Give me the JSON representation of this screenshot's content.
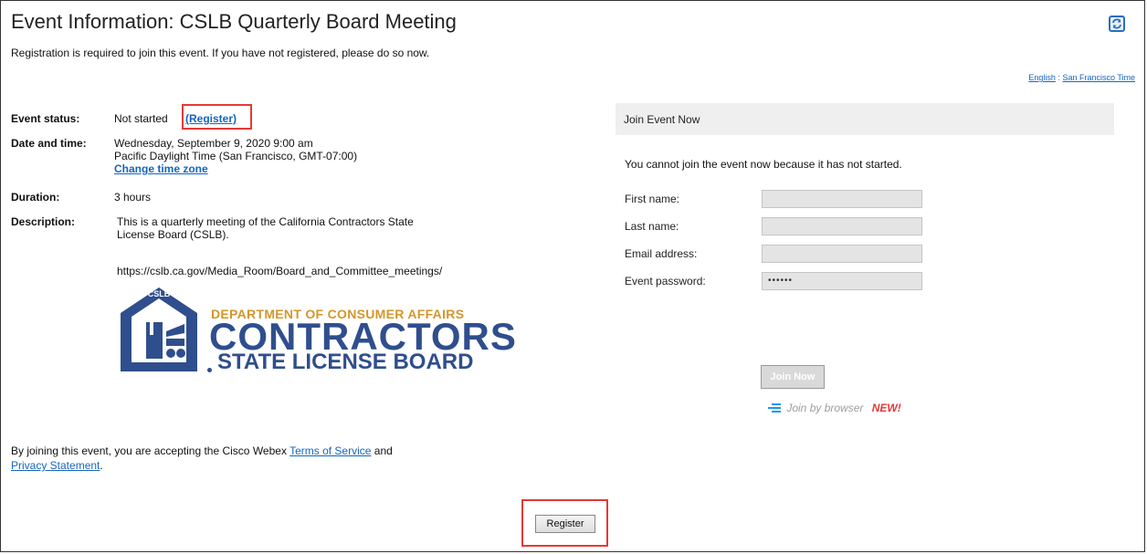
{
  "header": {
    "title": "Event Information: CSLB Quarterly Board Meeting",
    "intro": "Registration is required to join this event. If you have not registered, please do so now."
  },
  "locale": {
    "language_link": "English",
    "separator": ":",
    "timezone_link": "San Francisco Time"
  },
  "details": {
    "status_label": "Event status:",
    "status_value": "Not started",
    "register_link": "(Register)",
    "datetime_label": "Date and time:",
    "datetime_line1": "Wednesday, September 9, 2020 9:00 am",
    "datetime_line2": "Pacific Daylight Time (San Francisco, GMT-07:00)",
    "change_tz_link": "Change time zone",
    "duration_label": "Duration:",
    "duration_value": "3 hours",
    "description_label": "Description:",
    "description_line1": "This is a quarterly meeting of the California Contractors State",
    "description_line2": "License Board (CSLB).",
    "description_url": "https://cslb.ca.gov/Media_Room/Board_and_Committee_meetings/"
  },
  "logo": {
    "badge": "CSLB",
    "line1": "DEPARTMENT OF CONSUMER AFFAIRS",
    "line2": "CONTRACTORS",
    "line3": "STATE LICENSE BOARD"
  },
  "join_panel": {
    "header": "Join Event Now",
    "notice": "You cannot join the event now because it has not started.",
    "first_name_label": "First name:",
    "first_name_value": "",
    "last_name_label": "Last name:",
    "last_name_value": "",
    "email_label": "Email address:",
    "email_value": "",
    "password_label": "Event password:",
    "password_value": "••••••",
    "join_button": "Join Now",
    "browser_link": "Join by browser",
    "new_badge": "NEW!"
  },
  "footer": {
    "disclaimer_prefix": "By joining this event, you are accepting the Cisco Webex",
    "terms_link": "Terms of Service",
    "and_word": "and",
    "privacy_link": "Privacy Statement",
    "period": ".",
    "register_button": "Register"
  },
  "colors": {
    "link": "#1565c0",
    "highlight": "#e53935",
    "logo_blue": "#2f4e8d",
    "logo_gold": "#d4962a"
  }
}
